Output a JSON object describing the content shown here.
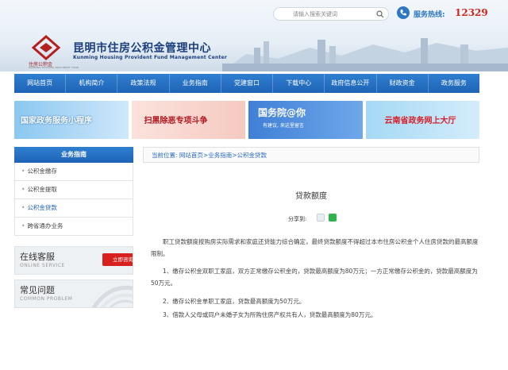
{
  "header": {
    "logo_text": "住房公积金",
    "logo_sub": "KUNMING HOUSING PROVIDENT FUND",
    "title_cn": "昆明市住房公积金管理中心",
    "title_en": "Kunming Housing Provident Fund Management Center",
    "search_placeholder": "请输入搜索关键词",
    "hotline_label": "服务热线:",
    "hotline_number": "12329"
  },
  "nav": {
    "items": [
      "网站首页",
      "机构简介",
      "政策法规",
      "业务指南",
      "党建窗口",
      "下载中心",
      "政府信息公开",
      "财政资金",
      "政务服务"
    ]
  },
  "banners": {
    "b1": "国家政务服务小程序",
    "b2": "扫黑除恶专项斗争",
    "b3": "国务院@你",
    "b3_sub": "有建议, 来这里留言",
    "b4": "云南省政务网上大厅"
  },
  "sidebar": {
    "head": "业务指南",
    "items": [
      "公积金缴存",
      "公积金提取",
      "公积金贷款",
      "跨省通办业务"
    ]
  },
  "services": {
    "online_title": "在线客服",
    "online_sub": "ONLINE SERVICE",
    "online_btn": "立即咨询",
    "faq_title": "常见问题",
    "faq_sub": "COMMON PROBLEM"
  },
  "breadcrumb": {
    "label": "当前位置:",
    "items": [
      "网站首页",
      "业务指南",
      "公积金贷款"
    ]
  },
  "article": {
    "title": "贷款额度",
    "share_label": "分享到:",
    "p1": "职工贷款额度按购房实际需求和家庭还贷能力综合确定，最终贷款额度不得超过本市住房公积金个人住房贷款的最高额度限制。",
    "p2": "1、缴存公积金双职工家庭，双方正常缴存公积金的，贷款最高额度为80万元；一方正常缴存公积金的，贷款最高额度为50万元。",
    "p3": "2、缴存公积金单职工家庭，贷款最高额度为50万元。",
    "p4": "3、借款人父母或同户未婚子女为所购住房产权共有人，贷款最高额度为80万元。"
  },
  "colors": {
    "nav_blue": "#1f63b6",
    "title_blue": "#1b3e7c",
    "hotline_red": "#d0261d",
    "consult_red": "#d8201e"
  }
}
